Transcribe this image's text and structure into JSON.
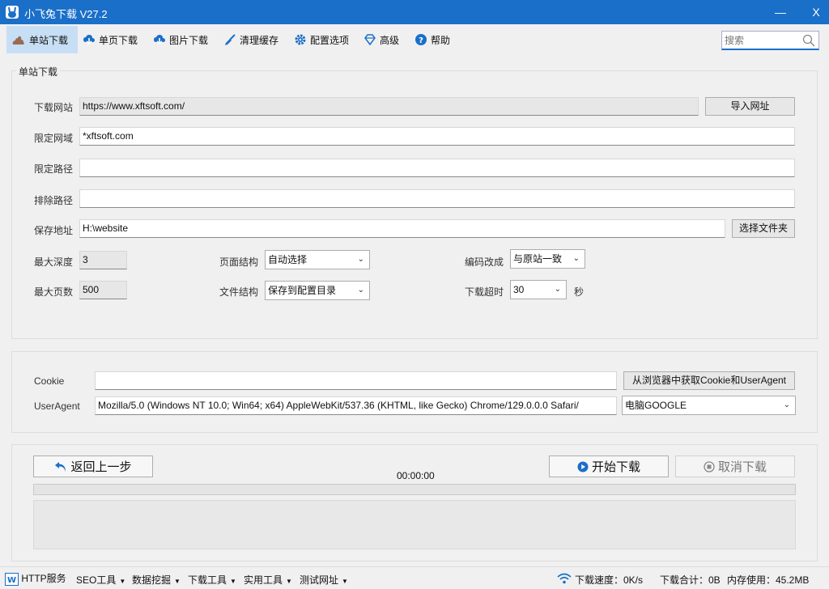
{
  "window": {
    "title": "小飞兔下载 V27.2",
    "minimize": "—",
    "close": "X"
  },
  "toolbar": {
    "items": [
      {
        "label": "单站下载",
        "icon": "poop-site-icon"
      },
      {
        "label": "单页下载",
        "icon": "download-cloud-icon"
      },
      {
        "label": "图片下载",
        "icon": "download-cloud-icon"
      },
      {
        "label": "清理缓存",
        "icon": "broom-icon"
      },
      {
        "label": "配置选项",
        "icon": "gear-icon"
      },
      {
        "label": "高级",
        "icon": "diamond-icon"
      },
      {
        "label": "帮助",
        "icon": "help-icon"
      }
    ],
    "search_placeholder": "搜索"
  },
  "site_download": {
    "legend": "单站下载",
    "url_label": "下载网站",
    "url_value": "https://www.xftsoft.com/",
    "import_button": "导入网址",
    "domain_label": "限定网域",
    "domain_value": "*xftsoft.com",
    "path_label": "限定路径",
    "path_value": "",
    "exclude_label": "排除路径",
    "exclude_value": "",
    "save_label": "保存地址",
    "save_value": "H:\\website",
    "choose_folder_button": "选择文件夹",
    "depth_label": "最大深度",
    "depth_value": "3",
    "pages_label": "最大页数",
    "pages_value": "500",
    "page_structure_label": "页面结构",
    "page_structure_value": "自动选择",
    "file_structure_label": "文件结构",
    "file_structure_value": "保存到配置目录",
    "encoding_label": "编码改成",
    "encoding_value": "与原站一致",
    "timeout_label": "下载超时",
    "timeout_value": "30",
    "timeout_unit": "秒"
  },
  "headers": {
    "cookie_label": "Cookie",
    "cookie_value": "",
    "get_cookie_button": "从浏览器中获取Cookie和UserAgent",
    "ua_label": "UserAgent",
    "ua_value": "Mozilla/5.0 (Windows NT 10.0; Win64; x64) AppleWebKit/537.36 (KHTML, like Gecko) Chrome/129.0.0.0 Safari/",
    "ua_preset": "电脑GOOGLE"
  },
  "controls": {
    "back_button": "返回上一步",
    "timer": "00:00:00",
    "start_button": "开始下载",
    "cancel_button": "取消下载",
    "progress": 0
  },
  "statusbar": {
    "http": "HTTP服务",
    "menus": [
      "SEO工具",
      "数据挖掘",
      "下载工具",
      "实用工具",
      "测试网址"
    ],
    "speed": "下载速度：0K/s",
    "total": "下载合计：0B",
    "memory": "内存使用：45.2MB"
  },
  "colors": {
    "titlebar": "#1a6fc9",
    "active_tab": "#c7dff4",
    "accent": "#1a6fc9"
  }
}
